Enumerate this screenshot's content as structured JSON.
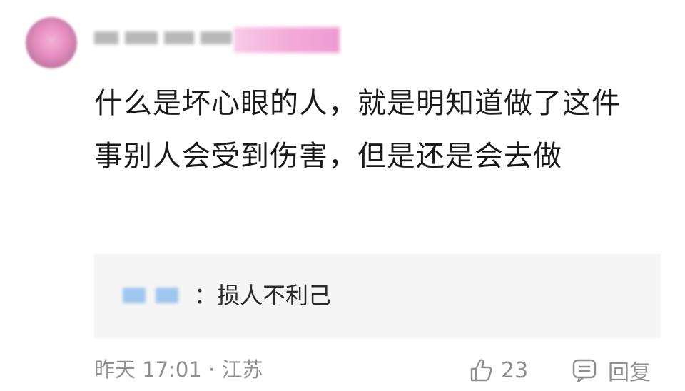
{
  "comment": {
    "username": "",
    "content": "什么是坏心眼的人，就是明知道做了这件事别人会受到伤害，但是还是会去做",
    "reply": {
      "author": "",
      "separator": "：",
      "text": "损人不利己"
    },
    "timestamp": "昨天 17:01 · 江苏",
    "likes": "23",
    "reply_label": "回复"
  },
  "icons": {
    "like": "thumbs-up-icon",
    "reply": "comment-icon"
  },
  "colors": {
    "text": "#1a1a1a",
    "muted": "#8f8f8f",
    "reply_bg": "#f5f5f5"
  }
}
